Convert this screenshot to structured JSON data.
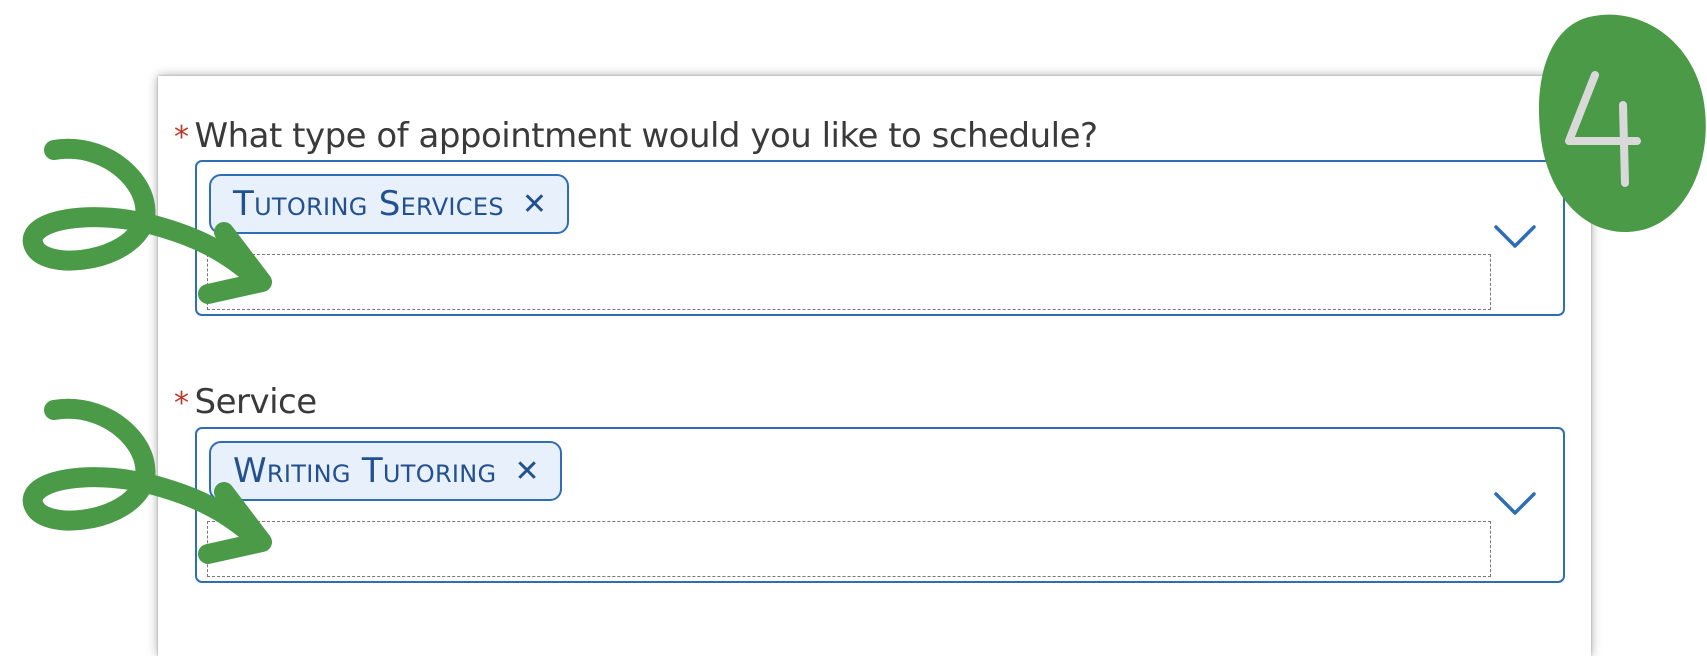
{
  "form": {
    "question_1": {
      "required_mark": "*",
      "label": "What type of appointment would you like to schedule?",
      "chip_label": "Tutoring Services",
      "chip_remove": "✕",
      "input_value": ""
    },
    "question_2": {
      "required_mark": "*",
      "label": "Service",
      "chip_label": "Writing Tutoring",
      "chip_remove": "✕",
      "input_value": ""
    }
  },
  "annotation": {
    "step_number": "4",
    "badge_color": "#4a9a48",
    "arrow_color": "#4a9a48",
    "icons": [
      "arrow-icon",
      "step-badge-icon"
    ]
  },
  "colors": {
    "accent": "#2f6db5",
    "chip_bg": "#e7f0fb",
    "required": "#c0392b"
  }
}
